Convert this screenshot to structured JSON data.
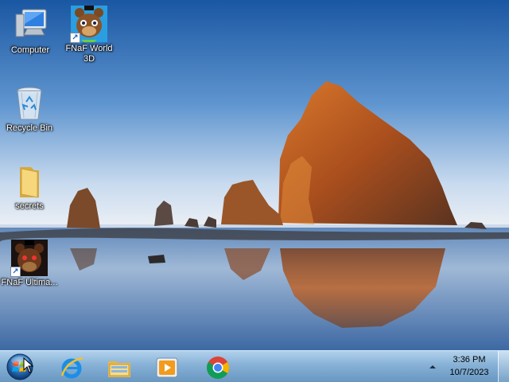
{
  "desktop": {
    "icons": [
      {
        "label": "Computer",
        "icon": "computer-icon"
      },
      {
        "label": "FNaF World 3D",
        "icon": "fnaf-world-icon",
        "shortcut": true
      },
      {
        "label": "Recycle Bin",
        "icon": "recycle-bin-icon"
      },
      {
        "label": "secrets",
        "icon": "folder-icon"
      },
      {
        "label": "FNaF Ultima...",
        "icon": "fnaf-ultimate-icon",
        "shortcut": true
      }
    ]
  },
  "taskbar": {
    "start": {
      "icon": "windows-start-orb"
    },
    "pinned": [
      {
        "name": "Internet Explorer",
        "icon": "internet-explorer-icon"
      },
      {
        "name": "Windows Explorer",
        "icon": "file-explorer-icon"
      },
      {
        "name": "Windows Media Player",
        "icon": "media-player-icon"
      },
      {
        "name": "Google Chrome",
        "icon": "chrome-icon"
      }
    ],
    "tray": {
      "chevron": "show-hidden-icons-chevron",
      "time": "3:36 PM",
      "date": "10/7/2023"
    }
  },
  "colors": {
    "sky_top": "#1f5fa8",
    "sky_horizon": "#d9e4f2",
    "rock": "#b8581f",
    "taskbar": "#7aa8d2"
  }
}
